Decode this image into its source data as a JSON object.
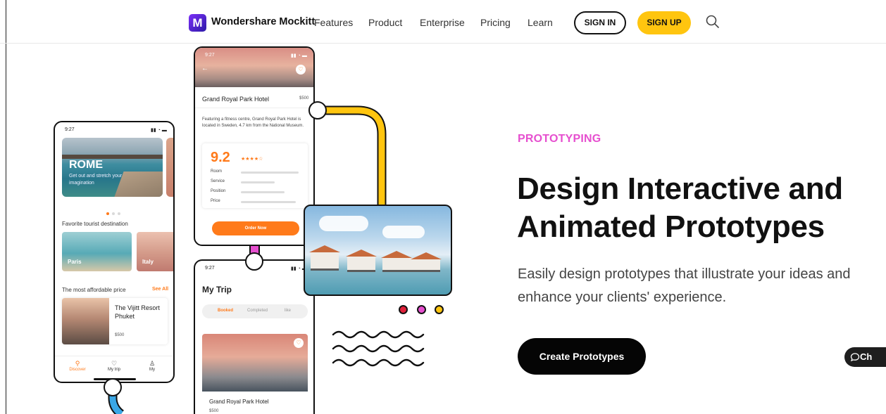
{
  "nav": {
    "brand": "Wondershare Mockitt",
    "logo_glyph": "M",
    "links": [
      "Features",
      "Product",
      "Enterprise",
      "Pricing",
      "Learn"
    ],
    "sign_in": "SIGN IN",
    "sign_up": "SIGN UP",
    "search_icon": "search-icon"
  },
  "hero": {
    "eyebrow": "PROTOTYPING",
    "title": "Design Interactive and Animated Prototypes",
    "description": "Easily design prototypes that illustrate your ideas and enhance your clients' experience.",
    "cta": "Create Prototypes",
    "chat_label": "Ch"
  },
  "phone_discover": {
    "time": "9:27",
    "city": "ROME",
    "city_tagline": "Get out and stretch your imagination",
    "section_favorites": "Favorite tourist destination",
    "destinations": [
      "Paris",
      "Italy"
    ],
    "section_affordable": "The most affordable price",
    "see_all": "See All",
    "resort_name": "The Vijitt Resort Phuket",
    "resort_price": "$500",
    "tabs": [
      {
        "label": "Discover",
        "icon": "search-icon"
      },
      {
        "label": "My trip",
        "icon": "heart-icon"
      },
      {
        "label": "My",
        "icon": "user-icon"
      }
    ]
  },
  "phone_hotel": {
    "time": "9:27",
    "hotel_name": "Grand Royal Park Hotel",
    "price": "$500",
    "description": "Featuring a fitness centre, Grand Royal Park Hotel is located in Sweden, 4.7 km from the National Museum.",
    "score": "9.2",
    "stars": "★★★★☆",
    "ratings": [
      "Room",
      "Service",
      "Position",
      "Price"
    ],
    "order_button": "Order Now"
  },
  "phone_trip": {
    "time": "9:27",
    "title": "My Trip",
    "segments": [
      "Booked",
      "Completed",
      "like"
    ],
    "hotel_name": "Grand Royal Park Hotel",
    "price": "$500"
  },
  "colors": {
    "accent_pink": "#e64fcf",
    "accent_yellow": "#ffc50f",
    "accent_orange": "#ff7a1a",
    "dot_colors": [
      "#e0203a",
      "#e64fcf",
      "#ffc50f"
    ]
  }
}
